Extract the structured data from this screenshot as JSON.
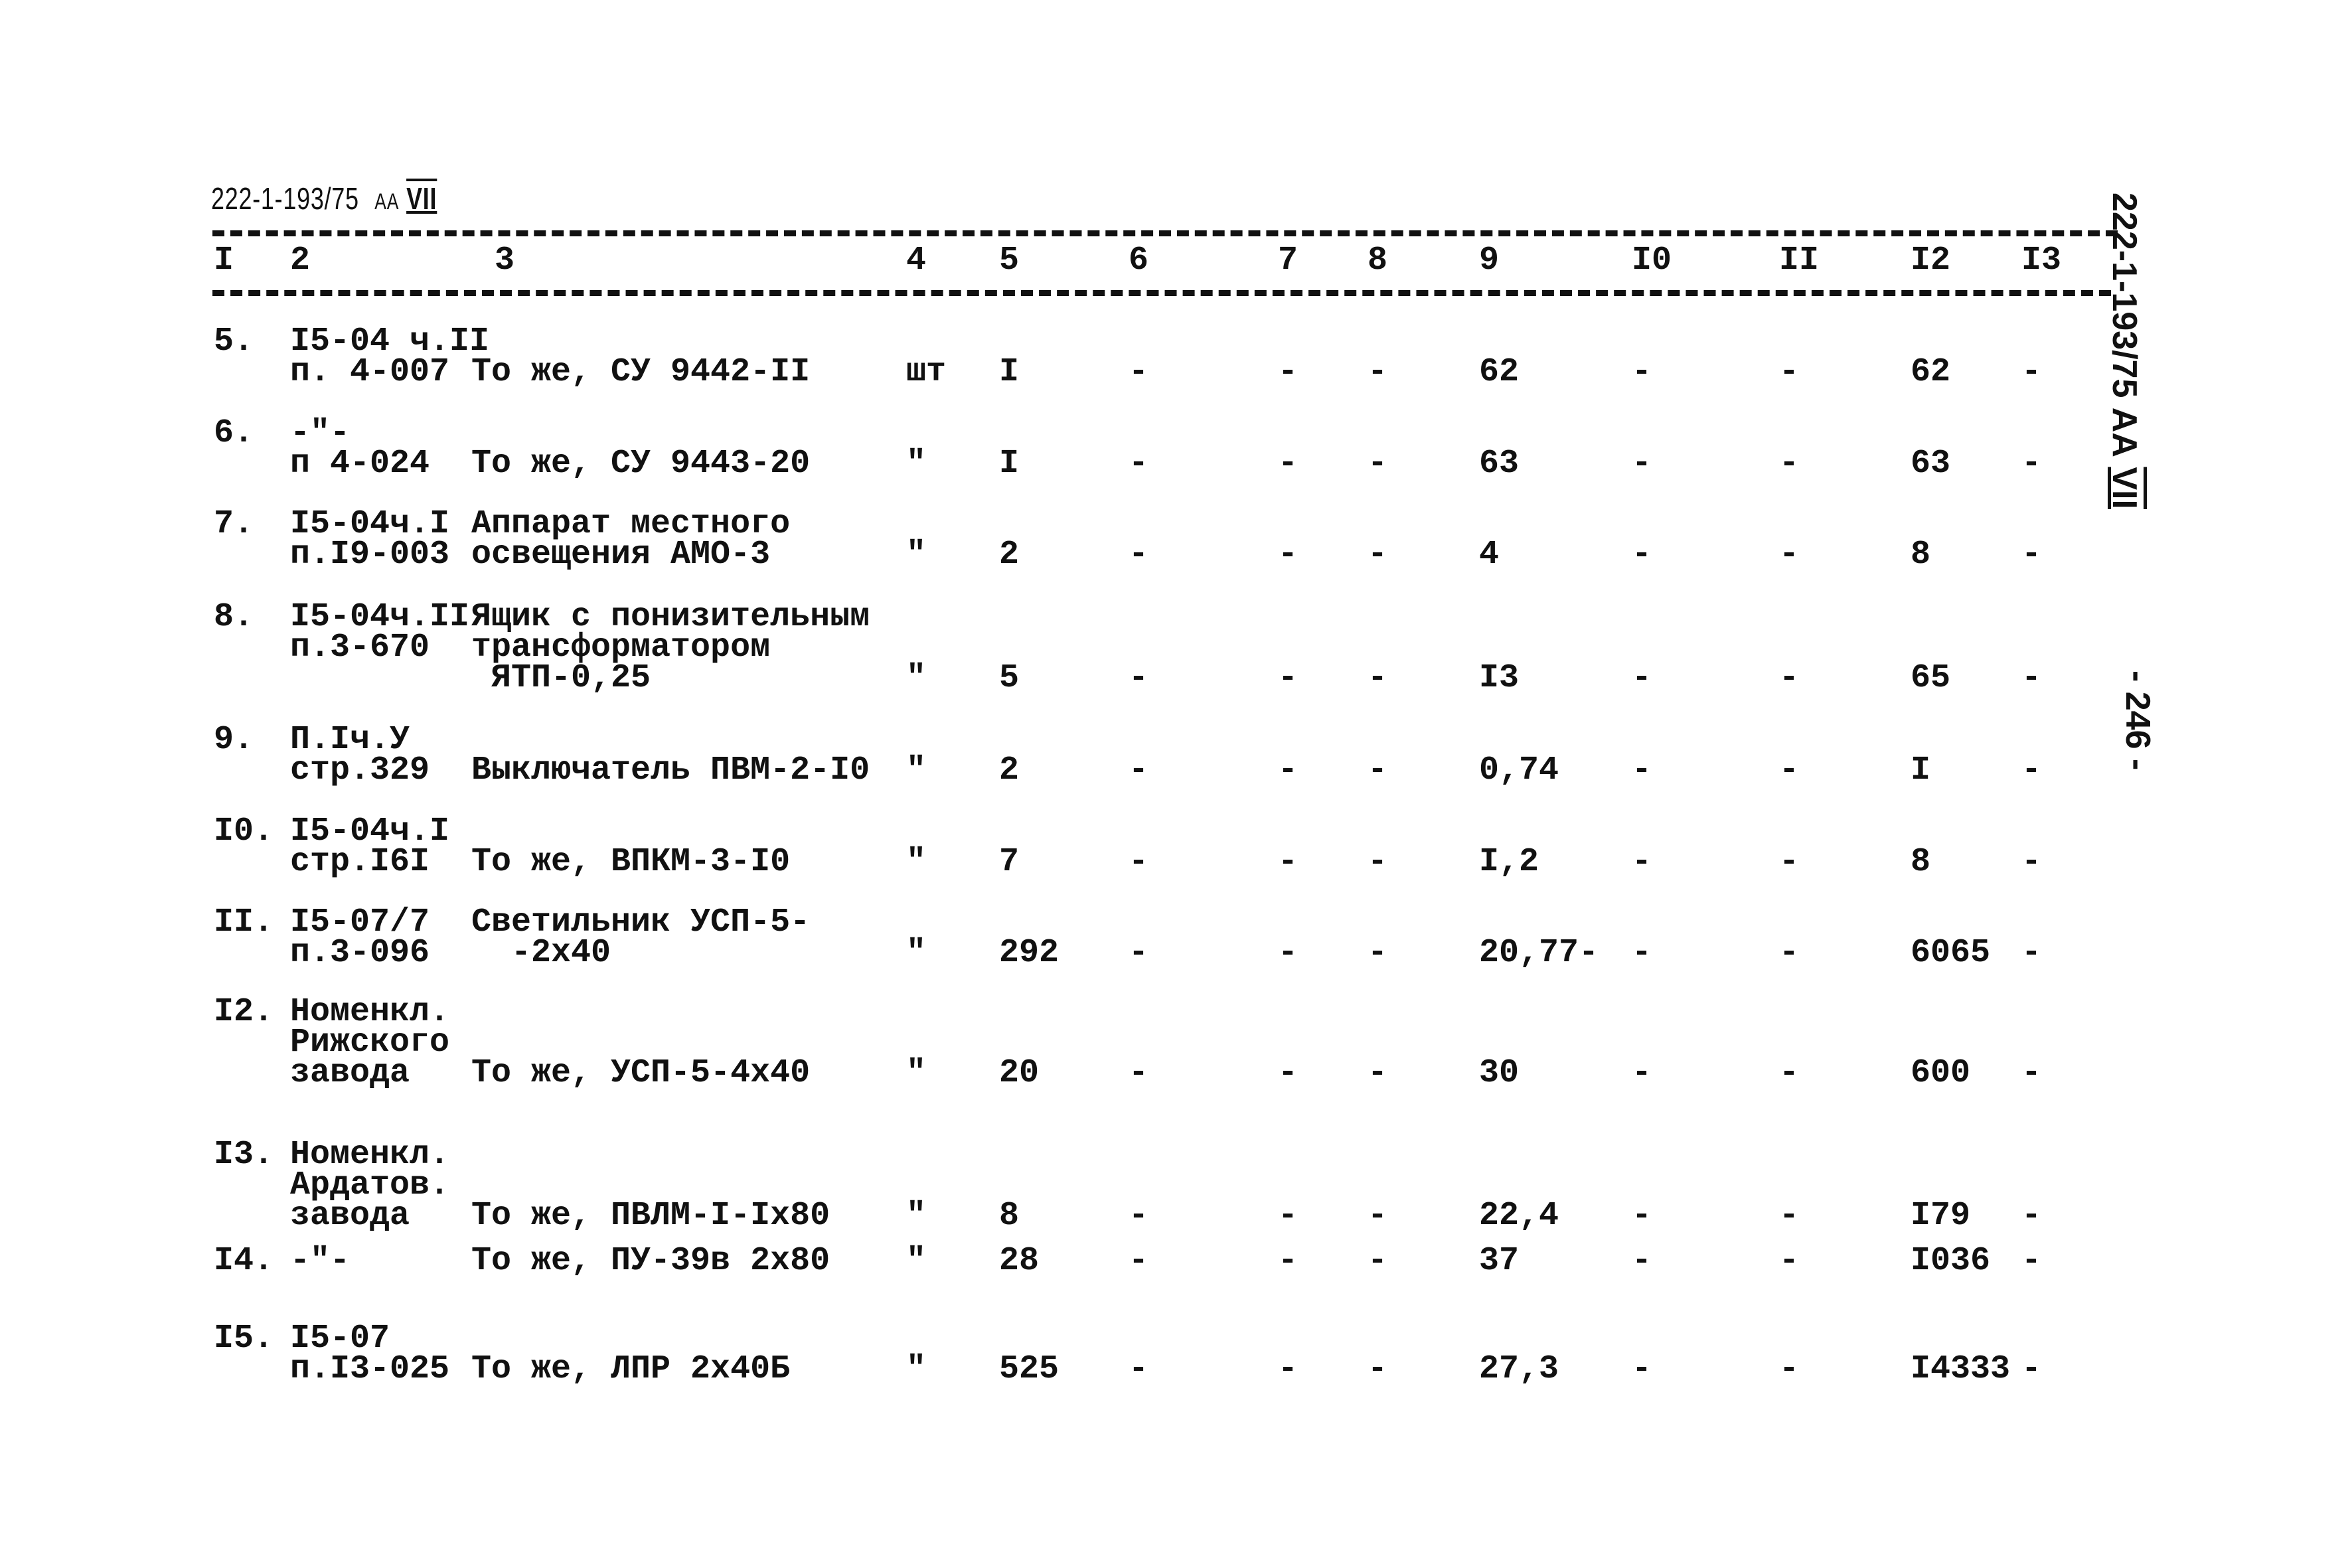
{
  "header": {
    "code": "222-1-193/75",
    "album": "АА",
    "sheet": "VII"
  },
  "columns": [
    "I",
    "2",
    "3",
    "4",
    "5",
    "6",
    "7",
    "8",
    "9",
    "I0",
    "II",
    "I2",
    "I3"
  ],
  "rows": [
    {
      "num": "5.",
      "ref": [
        "I5-04 ч.II",
        "п. 4-007"
      ],
      "name": [
        "То же, СУ 9442-II"
      ],
      "unit": "шт",
      "qty": "I",
      "c6": "-",
      "c7": "-",
      "c8": "-",
      "c9": "62",
      "c10": "-",
      "c11": "-",
      "c12": "62",
      "c13": "-"
    },
    {
      "num": "6.",
      "ref": [
        "-\"-",
        "п 4-024"
      ],
      "name": [
        "То же, СУ 9443-20"
      ],
      "unit": "\"",
      "qty": "I",
      "c6": "-",
      "c7": "-",
      "c8": "-",
      "c9": "63",
      "c10": "-",
      "c11": "-",
      "c12": "63",
      "c13": "-"
    },
    {
      "num": "7.",
      "ref": [
        "I5-04ч.I",
        "п.I9-003"
      ],
      "name": [
        "Аппарат местного",
        "освещения АМО-3"
      ],
      "unit": "\"",
      "qty": "2",
      "c6": "-",
      "c7": "-",
      "c8": "-",
      "c9": "4",
      "c10": "-",
      "c11": "-",
      "c12": "8",
      "c13": "-"
    },
    {
      "num": "8.",
      "ref": [
        "I5-04ч.II",
        "п.3-670"
      ],
      "name": [
        "Ящик с понизительным",
        "трансформатором",
        " ЯТП-0,25"
      ],
      "unit": "\"",
      "qty": "5",
      "c6": "-",
      "c7": "-",
      "c8": "-",
      "c9": "I3",
      "c10": "-",
      "c11": "-",
      "c12": "65",
      "c13": "-"
    },
    {
      "num": "9.",
      "ref": [
        "П.Iч.У",
        "стр.329"
      ],
      "name": [
        "Выключатель ПВМ-2-I0"
      ],
      "unit": "\"",
      "qty": "2",
      "c6": "-",
      "c7": "-",
      "c8": "-",
      "c9": "0,74",
      "c10": "-",
      "c11": "-",
      "c12": "I",
      "c13": "-"
    },
    {
      "num": "I0.",
      "ref": [
        "I5-04ч.I",
        "стр.I6I"
      ],
      "name": [
        "То же, ВПКМ-3-I0"
      ],
      "unit": "\"",
      "qty": "7",
      "c6": "-",
      "c7": "-",
      "c8": "-",
      "c9": "I,2",
      "c10": "-",
      "c11": "-",
      "c12": "8",
      "c13": "-"
    },
    {
      "num": "II.",
      "ref": [
        "I5-07/7",
        "п.3-096"
      ],
      "name": [
        "Светильник УСП-5-",
        "  -2х40"
      ],
      "unit": "\"",
      "qty": "292",
      "c6": "-",
      "c7": "-",
      "c8": "-",
      "c9": "20,77-",
      "c10": "-",
      "c11": "-",
      "c12": "6065",
      "c13": "-"
    },
    {
      "num": "I2.",
      "ref": [
        "Номенкл.",
        "Рижского",
        "завода"
      ],
      "name": [
        "То же, УСП-5-4х40"
      ],
      "unit": "\"",
      "qty": "20",
      "c6": "-",
      "c7": "-",
      "c8": "-",
      "c9": "30",
      "c10": "-",
      "c11": "-",
      "c12": "600",
      "c13": "-"
    },
    {
      "num": "I3.",
      "ref": [
        "Номенкл.",
        "Ардатов.",
        "завода"
      ],
      "name": [
        "То же, ПВЛМ-I-Iх80"
      ],
      "unit": "\"",
      "qty": "8",
      "c6": "-",
      "c7": "-",
      "c8": "-",
      "c9": "22,4",
      "c10": "-",
      "c11": "-",
      "c12": "I79",
      "c13": "-"
    },
    {
      "num": "I4.",
      "ref": [
        "-\"-"
      ],
      "name": [
        "То же, ПУ-39в 2х80"
      ],
      "unit": "\"",
      "qty": "28",
      "c6": "-",
      "c7": "-",
      "c8": "-",
      "c9": "37",
      "c10": "-",
      "c11": "-",
      "c12": "I036",
      "c13": "-"
    },
    {
      "num": "I5.",
      "ref": [
        "I5-07",
        "п.I3-025"
      ],
      "name": [
        "То же, ЛПР 2х40Б"
      ],
      "unit": "\"",
      "qty": "525",
      "c6": "-",
      "c7": "-",
      "c8": "-",
      "c9": "27,3",
      "c10": "-",
      "c11": "-",
      "c12": "I4333",
      "c13": "-"
    }
  ],
  "margin": {
    "side_code": "222-1-193/75 АА",
    "side_sheet": "VII",
    "page_number": "- 246 -"
  }
}
